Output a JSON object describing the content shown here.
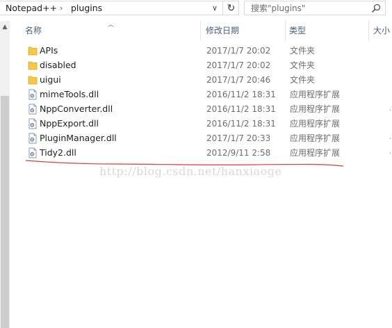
{
  "address": {
    "crumbs": [
      "Notepad++",
      "plugins"
    ],
    "separator": "›",
    "dropdown": "∨",
    "refresh": "↻"
  },
  "search": {
    "placeholder": "搜索\"plugins\""
  },
  "columns": {
    "name": "名称",
    "date": "修改日期",
    "type": "类型",
    "size": "大小"
  },
  "scrollbar": {
    "up": "▲"
  },
  "files": [
    {
      "name": "APIs",
      "date": "2017/1/7 20:02",
      "type": "文件夹",
      "icon": "folder-icon"
    },
    {
      "name": "disabled",
      "date": "2017/1/7 20:02",
      "type": "文件夹",
      "icon": "folder-icon"
    },
    {
      "name": "uigui",
      "date": "2017/1/7 20:46",
      "type": "文件夹",
      "icon": "folder-icon"
    },
    {
      "name": "mimeTools.dll",
      "date": "2016/11/2 18:31",
      "type": "应用程序扩展",
      "icon": "dll-file-icon"
    },
    {
      "name": "NppConverter.dll",
      "date": "2016/11/2 18:31",
      "type": "应用程序扩展",
      "icon": "dll-file-icon"
    },
    {
      "name": "NppExport.dll",
      "date": "2016/11/2 18:31",
      "type": "应用程序扩展",
      "icon": "dll-file-icon"
    },
    {
      "name": "PluginManager.dll",
      "date": "2017/1/7 20:33",
      "type": "应用程序扩展",
      "icon": "dll-file-icon"
    },
    {
      "name": "Tidy2.dll",
      "date": "2012/9/11 2:58",
      "type": "应用程序扩展",
      "icon": "dll-file-icon"
    }
  ],
  "watermark": "http://blog.csdn.net/hanxiaoge",
  "colors": {
    "folder": "#f6c843",
    "folder_dark": "#d9a520",
    "header_text": "#4c607a",
    "annotation": "#e0383a"
  }
}
